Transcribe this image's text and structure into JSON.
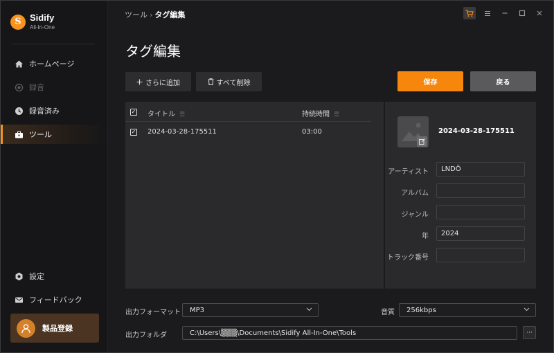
{
  "app": {
    "name": "Sidify",
    "subtitle": "All-In-One",
    "logo_letter": "S"
  },
  "sidebar": {
    "items": [
      {
        "label": "ホームページ",
        "icon": "home-icon",
        "state": "normal"
      },
      {
        "label": "録音",
        "icon": "record-icon",
        "state": "disabled"
      },
      {
        "label": "録音済み",
        "icon": "clock-icon",
        "state": "normal"
      },
      {
        "label": "ツール",
        "icon": "toolbox-icon",
        "state": "active"
      }
    ],
    "bottom_items": [
      {
        "label": "設定",
        "icon": "gear-icon"
      },
      {
        "label": "フィードバック",
        "icon": "mail-icon"
      }
    ],
    "register_label": "製品登録"
  },
  "breadcrumb": {
    "parent": "ツール",
    "separator": "›",
    "current": "タグ編集"
  },
  "page_title": "タグ編集",
  "toolbar": {
    "add_label": "さらに追加",
    "delete_label": "すべて削除",
    "save_label": "保存",
    "back_label": "戻る"
  },
  "table": {
    "columns": {
      "title": "タイトル",
      "duration": "持続時間"
    },
    "rows": [
      {
        "checked": true,
        "title": "2024-03-28-175511",
        "duration": "03:00"
      }
    ]
  },
  "details": {
    "song_title": "2024-03-28-175511",
    "fields": [
      {
        "label": "アーティスト",
        "value": "LNDÖ"
      },
      {
        "label": "アルバム",
        "value": ""
      },
      {
        "label": "ジャンル",
        "value": ""
      },
      {
        "label": "年",
        "value": "2024"
      },
      {
        "label": "トラック番号",
        "value": ""
      }
    ]
  },
  "output": {
    "format_label": "出力フォーマット",
    "format_value": "MP3",
    "quality_label": "音質",
    "quality_value": "256kbps",
    "folder_label": "出力フォルダ",
    "folder_value": "C:\\Users\\▒▒▒\\Documents\\Sidify All-In-One\\Tools",
    "more_label": "···"
  },
  "colors": {
    "accent": "#f7860c",
    "background": "#1b1b1d",
    "panel": "#2a2a2c",
    "sidebar": "#161618"
  }
}
